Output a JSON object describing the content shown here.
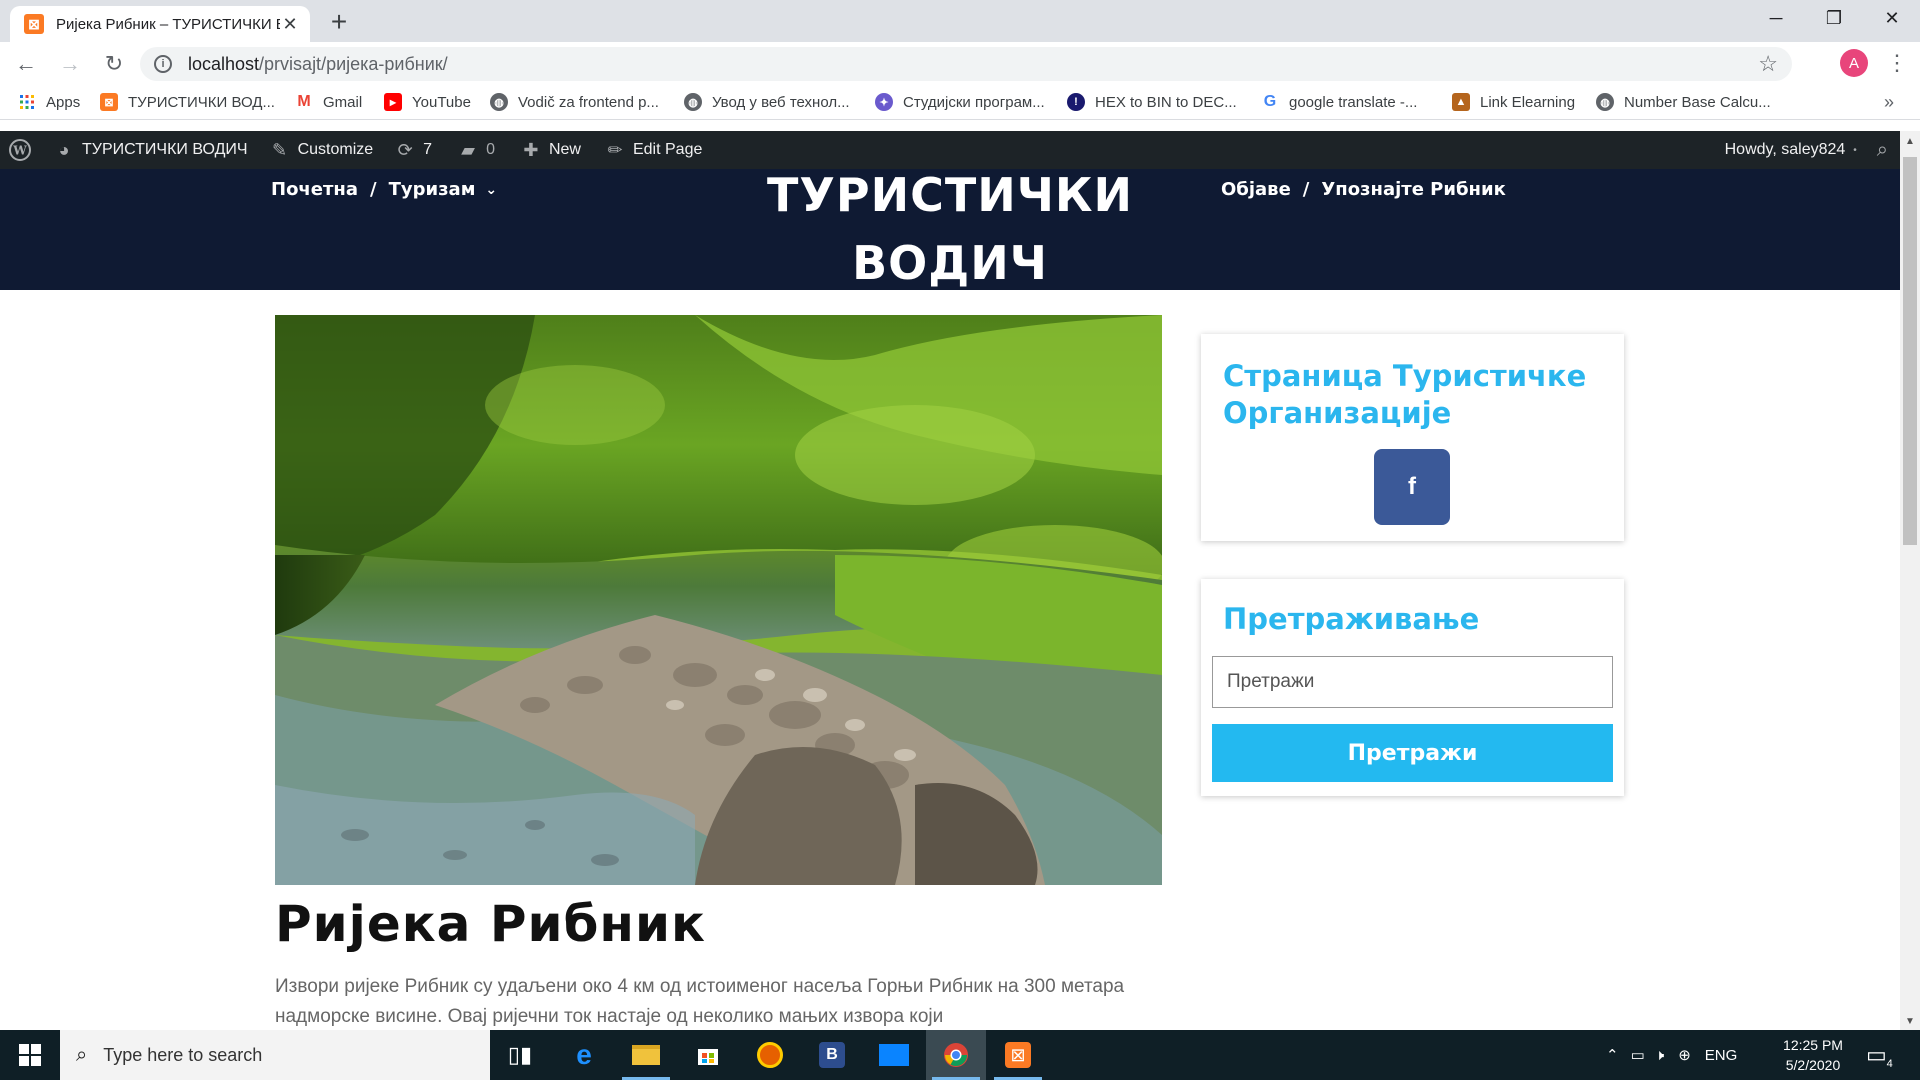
{
  "browser": {
    "tab_title": "Ријека Рибник – ТУРИСТИЧКИ В",
    "tab_favicon": "xampp-icon",
    "url_host": "localhost",
    "url_path": "/prvisajt/ријека-рибник/",
    "profile_initial": "A",
    "bookmarks": [
      {
        "label": "Apps",
        "icon": "apps-grid-icon",
        "color": "#1a73e8"
      },
      {
        "label": "ТУРИСТИЧКИ ВОД...",
        "icon": "xampp-icon",
        "color": "#fb7a24"
      },
      {
        "label": "Gmail",
        "icon": "gmail-icon",
        "color": "#ea4335"
      },
      {
        "label": "YouTube",
        "icon": "youtube-icon",
        "color": "#ff0000"
      },
      {
        "label": "Vodič za frontend p...",
        "icon": "globe-icon",
        "color": "#5f6368"
      },
      {
        "label": "Увод у веб технол...",
        "icon": "globe-icon",
        "color": "#5f6368"
      },
      {
        "label": "Студијски програм...",
        "icon": "university-icon",
        "color": "#6a5acd"
      },
      {
        "label": "HEX to BIN to DEC...",
        "icon": "hex-icon",
        "color": "#1a1a6e"
      },
      {
        "label": "google translate -...",
        "icon": "google-icon",
        "color": "#4285f4"
      },
      {
        "label": "Link Elearning",
        "icon": "graduation-cap-icon",
        "color": "#b5651d"
      },
      {
        "label": "Number Base Calcu...",
        "icon": "globe-icon",
        "color": "#5f6368"
      }
    ]
  },
  "adminbar": {
    "site_name": "ТУРИСТИЧКИ ВОДИЧ",
    "customize": "Customize",
    "updates_count": "7",
    "comments_count": "0",
    "new_label": "New",
    "edit_label": "Edit Page",
    "howdy": "Howdy, saley824"
  },
  "site": {
    "brand": "ТУРИСТИЧКИ ВОДИЧ",
    "nav_left": [
      "Почетна",
      "Туризам"
    ],
    "nav_right": [
      "Објаве",
      "Упознајте Рибник"
    ]
  },
  "post": {
    "title": "Ријека Рибник",
    "text": "Извори ријеке Рибник су удаљени око 4 км од истоименог насеља Горњи Рибник на 300 метара надморске висине. Овај ријечни ток настаје од неколико мањих извора који"
  },
  "sidebar": {
    "widget1_title": "Страница Туристичке Организације",
    "facebook_label": "f",
    "widget2_title": "Претраживање",
    "search_placeholder": "Претражи",
    "search_button": "Претражи"
  },
  "taskbar": {
    "search_placeholder": "Type here to search",
    "language": "ENG",
    "time": "12:25 PM",
    "date": "5/2/2020",
    "notifications": "4"
  },
  "colors": {
    "header_bg": "#0f1a33",
    "accent": "#23b9f0",
    "facebook": "#3b5998",
    "adminbar": "#1d2327"
  }
}
